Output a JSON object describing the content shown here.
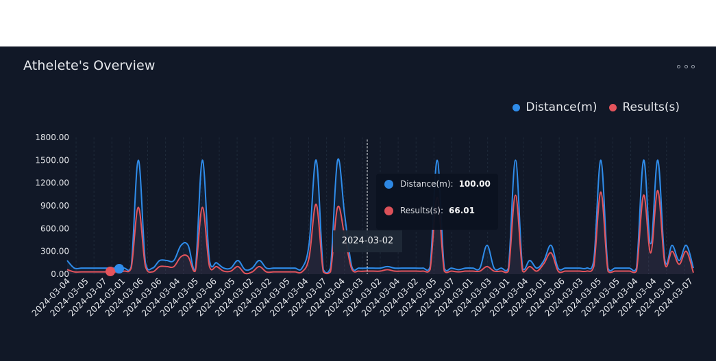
{
  "card": {
    "title": "Athelete's Overview",
    "menu_icon": "more-options-icon"
  },
  "colors": {
    "distance": "#2f8cea",
    "results": "#e4545c",
    "background": "#111827",
    "text": "#e5e7eb"
  },
  "tooltip": {
    "date": "2024-03-02",
    "rows": [
      {
        "label": "Distance(m):",
        "value": "100.00"
      },
      {
        "label": "Results(s):",
        "value": "66.01"
      }
    ]
  },
  "chart_data": {
    "type": "area",
    "title": "",
    "xlabel": "",
    "ylabel": "",
    "ylim": [
      0,
      1800
    ],
    "yticks": [
      "0.00",
      "300.00",
      "600.00",
      "900.00",
      "1200.00",
      "1500.00",
      "1800.00"
    ],
    "legend_position": "top-right",
    "grid": true,
    "categories": [
      "2024-03-04",
      "2024-03-05",
      "2024-03-07",
      "2024-03-01",
      "2024-03-06",
      "2024-03-06",
      "2024-03-04",
      "2024-03-05",
      "2024-03-06",
      "2024-03-05",
      "2024-03-02",
      "2024-03-02",
      "2024-03-05",
      "2024-03-04",
      "2024-03-07",
      "2024-03-04",
      "2024-03-03",
      "2024-03-02",
      "2024-03-04",
      "2024-03-02",
      "2024-03-05",
      "2024-03-07",
      "2024-03-01",
      "2024-03-03",
      "2024-03-01",
      "2024-03-04",
      "2024-03-01",
      "2024-03-06",
      "2024-03-03",
      "2024-03-05",
      "2024-03-05",
      "2024-03-04",
      "2024-03-04",
      "2024-03-01",
      "2024-03-07"
    ],
    "series": [
      {
        "name": "Distance(m)",
        "values": [
          180,
          80,
          80,
          80,
          80,
          80,
          80,
          80,
          80,
          100,
          1500,
          150,
          80,
          180,
          180,
          180,
          380,
          380,
          60,
          1500,
          180,
          150,
          80,
          80,
          180,
          60,
          80,
          180,
          80,
          80,
          80,
          80,
          80,
          80,
          400,
          1500,
          60,
          80,
          1500,
          780,
          100,
          80,
          80,
          80,
          80,
          100,
          80,
          80,
          80,
          80,
          80,
          100,
          1500,
          80,
          80,
          60,
          80,
          80,
          80,
          380,
          80,
          80,
          80,
          1500,
          80,
          180,
          80,
          180,
          380,
          80,
          80,
          80,
          80,
          80,
          180,
          1500,
          80,
          80,
          80,
          80,
          80,
          1500,
          400,
          1500,
          180,
          380,
          180,
          380,
          80
        ]
      },
      {
        "name": "Results(s)",
        "values": [
          60,
          30,
          30,
          30,
          30,
          30,
          30,
          30,
          40,
          80,
          880,
          100,
          30,
          100,
          100,
          100,
          230,
          230,
          40,
          880,
          100,
          100,
          40,
          40,
          100,
          10,
          30,
          100,
          30,
          30,
          30,
          30,
          30,
          30,
          220,
          920,
          30,
          30,
          880,
          500,
          66,
          40,
          40,
          40,
          40,
          60,
          40,
          40,
          40,
          40,
          40,
          60,
          1010,
          40,
          40,
          30,
          40,
          40,
          40,
          100,
          40,
          40,
          40,
          1040,
          40,
          100,
          40,
          140,
          280,
          40,
          40,
          40,
          40,
          40,
          100,
          1080,
          40,
          40,
          40,
          40,
          40,
          1040,
          280,
          1100,
          130,
          300,
          130,
          300,
          20
        ]
      }
    ]
  }
}
